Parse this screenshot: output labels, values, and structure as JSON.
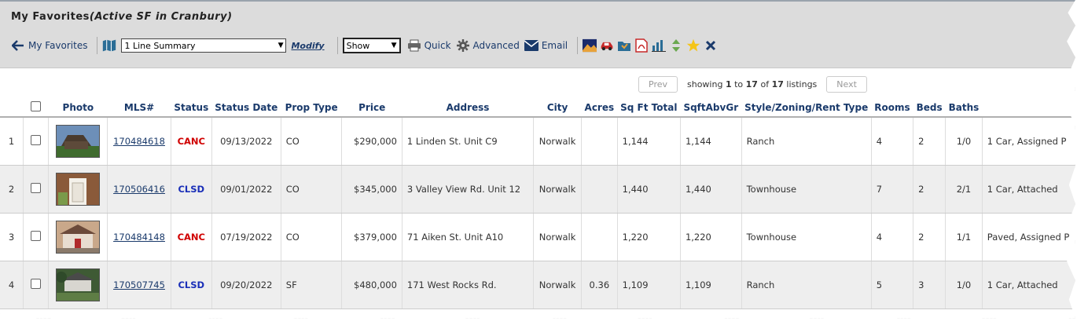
{
  "header": {
    "title": "My Favorites",
    "subtitle": "(Active SF in Cranbury)"
  },
  "toolbar": {
    "back_label": "My Favorites",
    "view_select": "1 Line Summary",
    "modify_label": "Modify",
    "show_select": "Show",
    "quick_label": "Quick",
    "advanced_label": "Advanced",
    "email_label": "Email"
  },
  "pager": {
    "prev_label": "Prev",
    "showing_prefix": "showing",
    "from": "1",
    "to_word": "to",
    "to": "17",
    "of_word": "of",
    "total": "17",
    "suffix": "listings",
    "next_label": "Next"
  },
  "columns": [
    "Photo",
    "MLS#",
    "Status",
    "Status Date",
    "Prop Type",
    "Price",
    "Address",
    "City",
    "Acres",
    "Sq Ft Total",
    "SqftAbvGr",
    "Style/Zoning/Rent Type",
    "Rooms",
    "Beds",
    "Baths"
  ],
  "rows": [
    {
      "num": "1",
      "mls": "170484618",
      "status": "CANC",
      "date": "09/13/2022",
      "type": "CO",
      "price": "$290,000",
      "address": "1 Linden St. Unit C9",
      "city": "Norwalk",
      "acres": "",
      "sqft": "1,144",
      "abvgr": "1,144",
      "style": "Ranch",
      "rooms": "4",
      "beds": "2",
      "baths": "1/0",
      "extra": "1 Car, Assigned P"
    },
    {
      "num": "2",
      "mls": "170506416",
      "status": "CLSD",
      "date": "09/01/2022",
      "type": "CO",
      "price": "$345,000",
      "address": "3 Valley View Rd. Unit 12",
      "city": "Norwalk",
      "acres": "",
      "sqft": "1,440",
      "abvgr": "1,440",
      "style": "Townhouse",
      "rooms": "7",
      "beds": "2",
      "baths": "2/1",
      "extra": "1 Car, Attached"
    },
    {
      "num": "3",
      "mls": "170484148",
      "status": "CANC",
      "date": "07/19/2022",
      "type": "CO",
      "price": "$379,000",
      "address": "71 Aiken St. Unit A10",
      "city": "Norwalk",
      "acres": "",
      "sqft": "1,220",
      "abvgr": "1,220",
      "style": "Townhouse",
      "rooms": "4",
      "beds": "2",
      "baths": "1/1",
      "extra": "Paved, Assigned P"
    },
    {
      "num": "4",
      "mls": "170507745",
      "status": "CLSD",
      "date": "09/20/2022",
      "type": "SF",
      "price": "$480,000",
      "address": "171 West Rocks Rd.",
      "city": "Norwalk",
      "acres": "0.36",
      "sqft": "1,109",
      "abvgr": "1,109",
      "style": "Ranch",
      "rooms": "5",
      "beds": "3",
      "baths": "1/0",
      "extra": "1 Car, Attached"
    }
  ]
}
